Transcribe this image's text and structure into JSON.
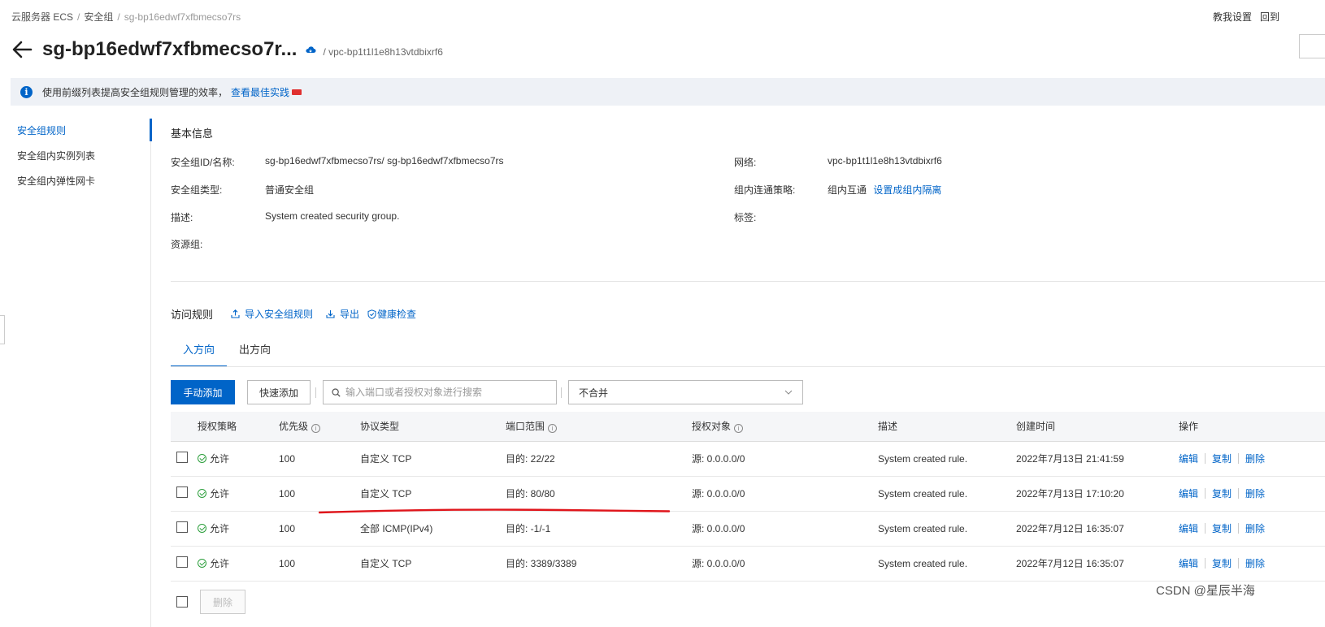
{
  "breadcrumb": {
    "item1": "云服务器 ECS",
    "item2": "安全组",
    "current": "sg-bp16edwf7xfbmecso7rs"
  },
  "top_right": {
    "settings": "教我设置",
    "back": "回到"
  },
  "header": {
    "title": "sg-bp16edwf7xfbmecso7r...",
    "vpc_sub": "/ vpc-bp1t1l1e8h13vtdbixrf6"
  },
  "tip": {
    "text": "使用前缀列表提高安全组规则管理的效率，",
    "link": "查看最佳实践"
  },
  "sidebar": {
    "items": [
      {
        "label": "安全组规则"
      },
      {
        "label": "安全组内实例列表"
      },
      {
        "label": "安全组内弹性网卡"
      }
    ]
  },
  "basic_info": {
    "title": "基本信息",
    "id_label": "安全组ID/名称:",
    "id_value": "sg-bp16edwf7xfbmecso7rs/ sg-bp16edwf7xfbmecso7rs",
    "type_label": "安全组类型:",
    "type_value": "普通安全组",
    "desc_label": "描述:",
    "desc_value": "System created security group.",
    "rg_label": "资源组:",
    "network_label": "网络:",
    "network_value": "vpc-bp1t1l1e8h13vtdbixrf6",
    "policy_label": "组内连通策略:",
    "policy_value": "组内互通",
    "policy_link": "设置成组内隔离",
    "tags_label": "标签:"
  },
  "rules": {
    "title": "访问规则",
    "import_link": "导入安全组规则",
    "export_link": "导出",
    "health_link": "健康检查",
    "tabs": [
      "入方向",
      "出方向"
    ],
    "add_button": "手动添加",
    "quick_add_button": "快速添加",
    "search_placeholder": "输入端口或者授权对象进行搜索",
    "merge_select": "不合并",
    "columns": {
      "policy": "授权策略",
      "priority": "优先级",
      "protocol": "协议类型",
      "port": "端口范围",
      "target": "授权对象",
      "desc": "描述",
      "created": "创建时间",
      "ops": "操作"
    },
    "rows": [
      {
        "policy": "允许",
        "priority": "100",
        "protocol": "自定义 TCP",
        "port": "目的: 22/22",
        "target": "源: 0.0.0.0/0",
        "desc": "System created rule.",
        "created": "2022年7月13日 21:41:59"
      },
      {
        "policy": "允许",
        "priority": "100",
        "protocol": "自定义 TCP",
        "port": "目的: 80/80",
        "target": "源: 0.0.0.0/0",
        "desc": "System created rule.",
        "created": "2022年7月13日 17:10:20"
      },
      {
        "policy": "允许",
        "priority": "100",
        "protocol": "全部 ICMP(IPv4)",
        "port": "目的: -1/-1",
        "target": "源: 0.0.0.0/0",
        "desc": "System created rule.",
        "created": "2022年7月12日 16:35:07"
      },
      {
        "policy": "允许",
        "priority": "100",
        "protocol": "自定义 TCP",
        "port": "目的: 3389/3389",
        "target": "源: 0.0.0.0/0",
        "desc": "System created rule.",
        "created": "2022年7月12日 16:35:07"
      }
    ],
    "ops": {
      "edit": "编辑",
      "copy": "复制",
      "delete": "删除"
    },
    "bulk_delete": "删除"
  },
  "watermark": "CSDN @星辰半海",
  "colors": {
    "accent": "#0064c8",
    "allow_green": "#2c9f3c",
    "annotation_red": "#e0151b"
  }
}
